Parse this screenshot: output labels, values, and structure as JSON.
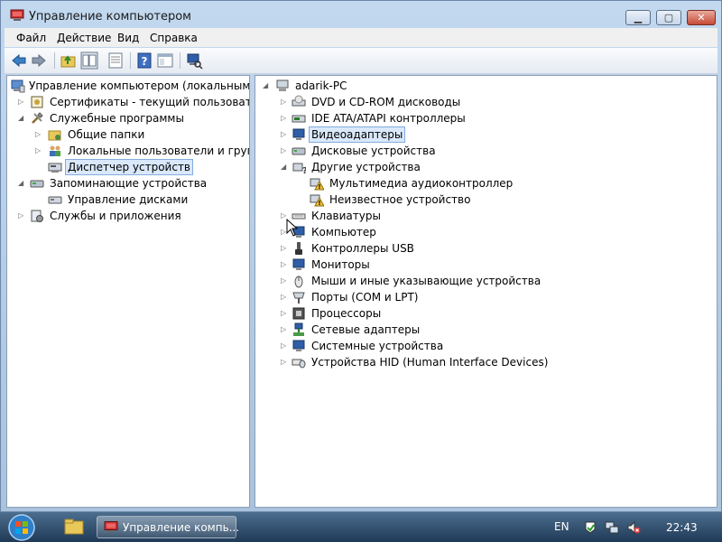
{
  "window": {
    "title": "Управление компьютером"
  },
  "menu": {
    "items": [
      "Файл",
      "Действие",
      "Вид",
      "Справка"
    ]
  },
  "toolbar": {
    "buttons": [
      "back-arrow-icon",
      "forward-arrow-icon",
      "up-folder-icon",
      "show-hide-tree-icon",
      "properties-icon",
      "help-icon",
      "console-view-icon",
      "device-scan-icon"
    ]
  },
  "left_tree": {
    "items": [
      {
        "label": "Управление компьютером (локальным)",
        "icon": "computer-management-icon"
      },
      {
        "label": "Сертификаты - текущий пользователь",
        "icon": "certificates-icon"
      },
      {
        "label": "Служебные программы",
        "icon": "system-tools-icon"
      },
      {
        "label": "Общие папки",
        "icon": "shared-folders-icon"
      },
      {
        "label": "Локальные пользователи и группы",
        "icon": "users-groups-icon"
      },
      {
        "label": "Диспетчер устройств",
        "icon": "device-manager-icon"
      },
      {
        "label": "Запоминающие устройства",
        "icon": "storage-icon"
      },
      {
        "label": "Управление дисками",
        "icon": "disk-management-icon"
      },
      {
        "label": "Службы и приложения",
        "icon": "services-apps-icon"
      }
    ]
  },
  "right_tree": {
    "items": [
      {
        "label": "adarik-PC",
        "icon": "pc-icon"
      },
      {
        "label": "DVD и CD-ROM дисководы",
        "icon": "dvd-drive-icon"
      },
      {
        "label": "IDE ATA/ATAPI контроллеры",
        "icon": "ide-controller-icon"
      },
      {
        "label": "Видеоадаптеры",
        "icon": "display-adapter-icon"
      },
      {
        "label": "Дисковые устройства",
        "icon": "disk-drive-icon"
      },
      {
        "label": "Другие устройства",
        "icon": "other-devices-icon"
      },
      {
        "label": "Мультимедиа аудиоконтроллер",
        "icon": "warning-device-icon"
      },
      {
        "label": "Неизвестное устройство",
        "icon": "warning-device-icon"
      },
      {
        "label": "Клавиатуры",
        "icon": "keyboard-icon"
      },
      {
        "label": "Компьютер",
        "icon": "computer-icon"
      },
      {
        "label": "Контроллеры USB",
        "icon": "usb-icon"
      },
      {
        "label": "Мониторы",
        "icon": "monitor-icon"
      },
      {
        "label": "Мыши и иные указывающие устройства",
        "icon": "mouse-icon"
      },
      {
        "label": "Порты (COM и LPT)",
        "icon": "ports-icon"
      },
      {
        "label": "Процессоры",
        "icon": "processor-icon"
      },
      {
        "label": "Сетевые адаптеры",
        "icon": "network-adapter-icon"
      },
      {
        "label": "Системные устройства",
        "icon": "system-devices-icon"
      },
      {
        "label": "Устройства HID (Human Interface Devices)",
        "icon": "hid-icon"
      }
    ]
  },
  "taskbar": {
    "task_label": "Управление компь...",
    "language": "EN",
    "clock": "22:43"
  },
  "colors": {
    "selection": "#d9e8fb",
    "warning": "#f4c430"
  }
}
